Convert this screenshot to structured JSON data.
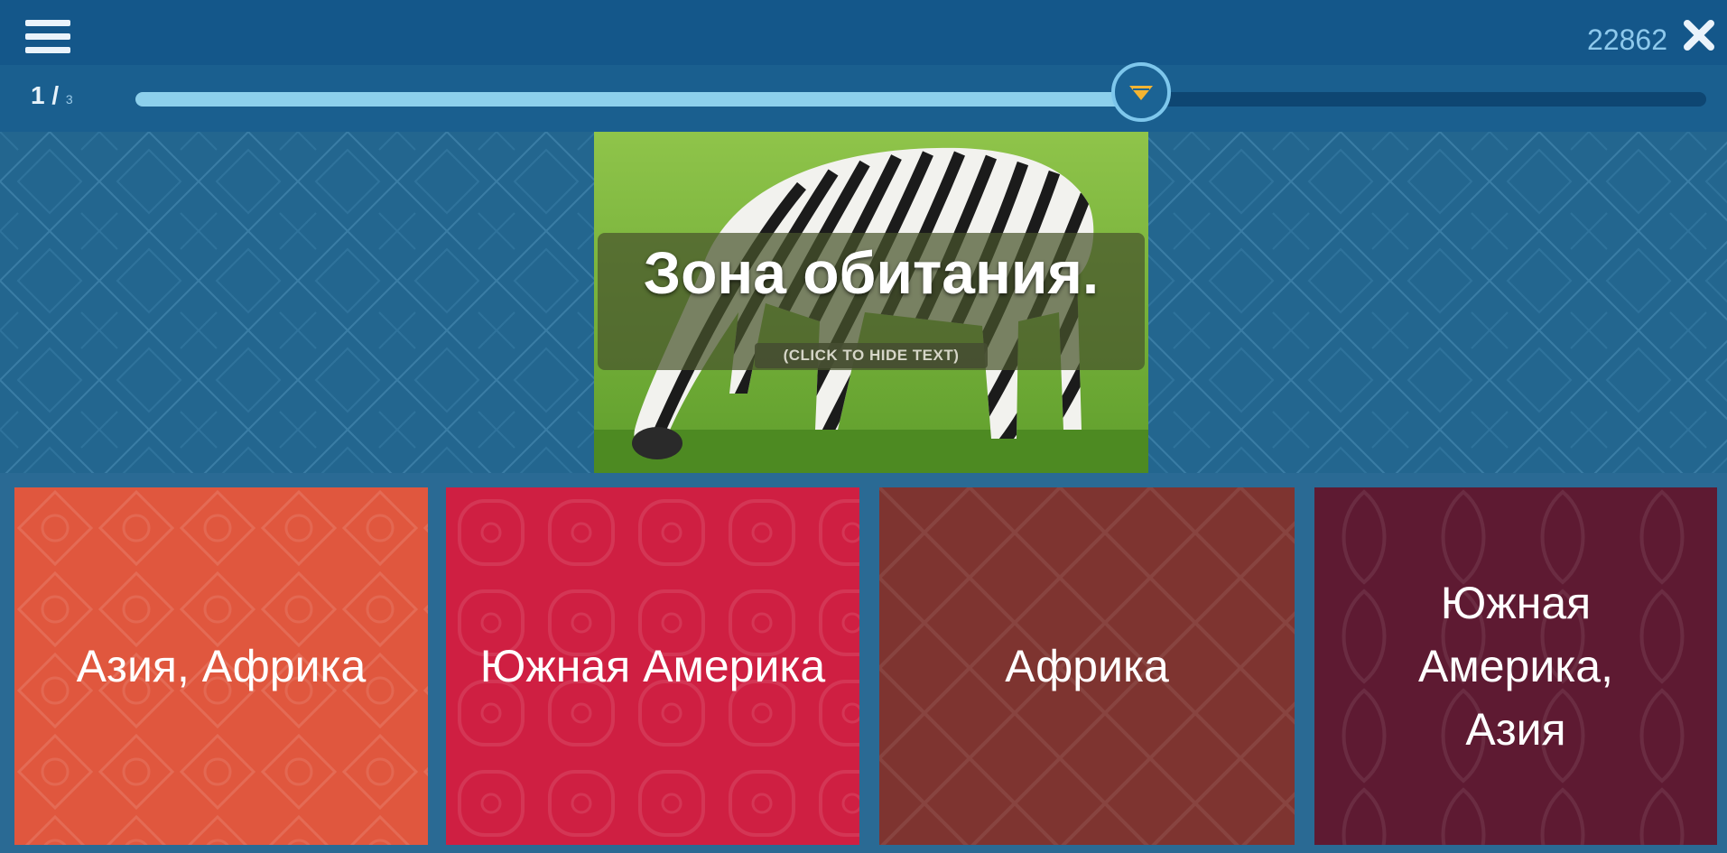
{
  "header": {
    "menu_icon": "hamburger-menu-icon",
    "score": "22862",
    "close_icon": "close-x-icon"
  },
  "progress": {
    "current": "1 /",
    "total": "3",
    "fill_fraction": 0.64,
    "knob_icon": "chevron-down-icon"
  },
  "question": {
    "text": "Зона обитания.",
    "hide_hint": "(CLICK TO HIDE TEXT)",
    "image_subject": "zebra-grazing"
  },
  "answers": [
    {
      "label": "Азия, Африка",
      "color": "#e0573e"
    },
    {
      "label": "Южная Америка",
      "color": "#cf1f42"
    },
    {
      "label": "Африка",
      "color": "#7e3430"
    },
    {
      "label": "Южная\nАмерика,\nАзия",
      "color": "#5e1a32"
    }
  ],
  "colors": {
    "header_bg": "#14578a",
    "progress_fill": "#8dd0ec",
    "question_bg": "#23668f",
    "score_text": "#8ec9ec"
  }
}
